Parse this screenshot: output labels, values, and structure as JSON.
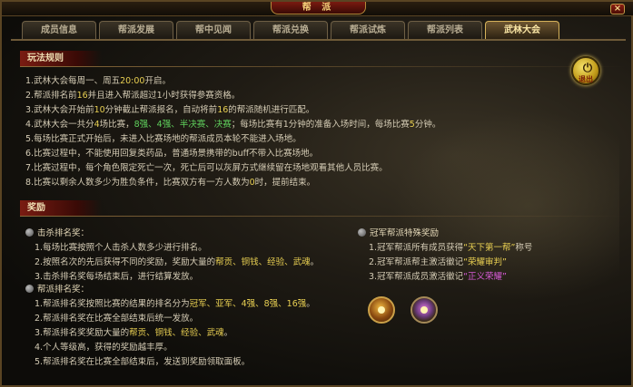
{
  "window": {
    "title": "帮 派",
    "close_label": "×"
  },
  "tabs": [
    {
      "label": "成员信息",
      "active": false
    },
    {
      "label": "帮派发展",
      "active": false
    },
    {
      "label": "帮中见闻",
      "active": false
    },
    {
      "label": "帮派兑换",
      "active": false
    },
    {
      "label": "帮派试炼",
      "active": false
    },
    {
      "label": "帮派列表",
      "active": false
    },
    {
      "label": "武林大会",
      "active": true
    }
  ],
  "exit_button": {
    "label": "退出"
  },
  "rules": {
    "heading": "玩法规则",
    "lines": [
      {
        "p1": "1.武林大会每周一、周五",
        "p2": "20:00",
        "p3": "开启。"
      },
      {
        "p1": "2.帮派排名前",
        "p2": "16",
        "p3": "并且进入帮派超过1小时获得参赛资格。"
      },
      {
        "p1": "3.武林大会开始前",
        "p2": "10",
        "p3": "分钟截止帮派报名，自动将前",
        "p4": "16",
        "p5": "的帮派随机进行匹配。"
      },
      {
        "p1": "4.武林大会一共分",
        "p2": "4",
        "p3": "场比赛，",
        "p4": "8强、4强、半决赛、决赛",
        "p5": "；每场比赛有1分钟的准备入场时间，每场比赛",
        "p6": "5",
        "p7": "分钟。"
      },
      {
        "p1": "5.每场比赛正式开始后，未进入比赛场地的帮派成员本轮不能进入场地。"
      },
      {
        "p1": "6.比赛过程中，不能使用回复类药品，普通场景携带的buff不带入比赛场地。"
      },
      {
        "p1": "7.比赛过程中，每个角色限定死亡一次，死亡后可以灰屏方式继续留在场地观看其他人员比赛。"
      },
      {
        "p1": "8.比赛以剩余人数多少为胜负条件，比赛双方有一方人数为",
        "p2": "0",
        "p3": "时，提前结束。"
      }
    ]
  },
  "rewards": {
    "heading": "奖励",
    "kill_rank": {
      "title": "击杀排名奖：",
      "lines": [
        {
          "p1": "1.每场比赛按照个人击杀人数多少进行排名。"
        },
        {
          "p1": "2.按照名次的先后获得不同的奖励，奖励大量的",
          "p2": "帮贡、铜钱、经验、武魂",
          "p3": "。"
        },
        {
          "p1": "3.击杀排名奖每场结束后，进行结算发放。"
        }
      ]
    },
    "guild_rank": {
      "title": "帮派排名奖：",
      "lines": [
        {
          "p1": "1.帮派排名奖按照比赛的结果的排名分为",
          "p2": "冠军、亚军、4强、8强、16强",
          "p3": "。"
        },
        {
          "p1": "2.帮派排名奖在比赛全部结束后统一发放。"
        },
        {
          "p1": "3.帮派排名奖奖励大量的",
          "p2": "帮贡、铜钱、经验、武魂",
          "p3": "。"
        },
        {
          "p1": "4.个人等级高，获得的奖励越丰厚。"
        },
        {
          "p1": "5.帮派排名奖在比赛全部结束后，发送到奖励领取面板。"
        }
      ]
    },
    "champion": {
      "title": "冠军帮派特殊奖励",
      "lines": [
        {
          "p1": "1.冠军帮派所有成员获得",
          "p2": "“天下第一帮”",
          "p3": "称号"
        },
        {
          "p1": "2.冠军帮派帮主激活徽记",
          "p2": "“荣耀审判”"
        },
        {
          "p1": "3.冠军帮派成员激活徽记",
          "p2": "“正义荣耀”"
        }
      ]
    }
  },
  "colors": {
    "accent_gold": "#e8cf52",
    "accent_green": "#5fd05c",
    "accent_red": "#e25a3c",
    "accent_purple": "#d85bd8",
    "frame": "#5a4423"
  }
}
